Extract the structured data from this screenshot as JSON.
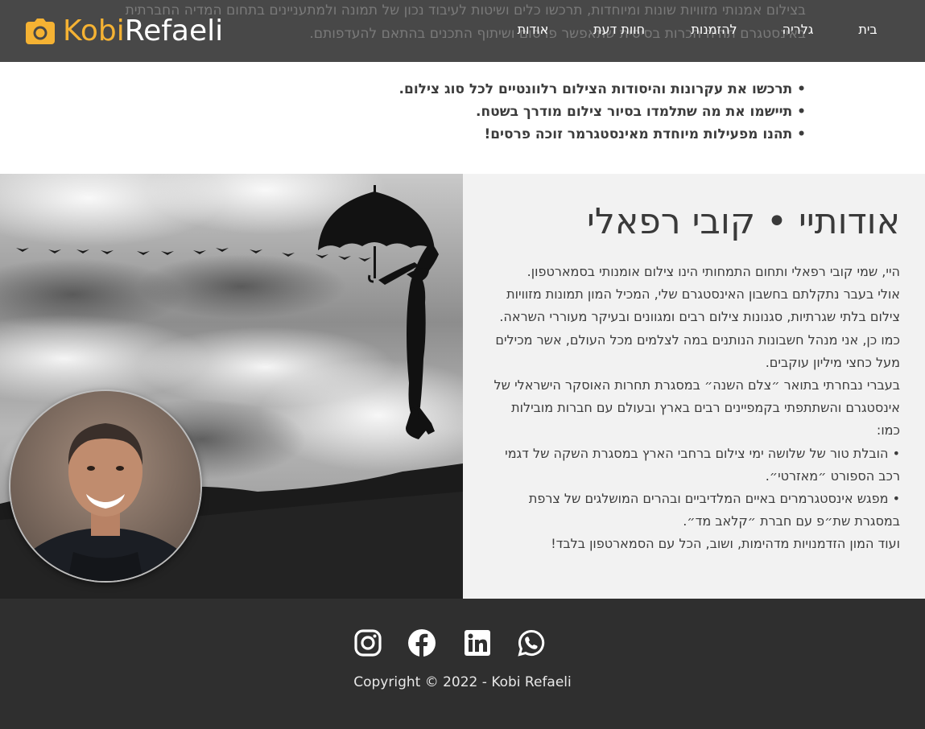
{
  "header": {
    "logo_part1": "Kobi",
    "logo_part2": "Refaeli",
    "nav": [
      {
        "label": "בית"
      },
      {
        "label": "גלריה"
      },
      {
        "label": "להזמנות"
      },
      {
        "label": "חוות דעת"
      },
      {
        "label": "אודות"
      }
    ],
    "behind_text_line1": "בצילום אמנותי מזוויות שונות ומיוחדות, תרכשו כלים ושיטות לעיבוד נכון של תמונה ולמתעניינים בתחום המדיה החברתית",
    "behind_text_line2": "באינסטגרם תהיה הכרות בסיסית שתאפשר פרסום ושיתוף התכנים בהתאם להעדפותם."
  },
  "bullets": [
    "• תרכשו את עקרונות והיסודות הצילום רלוונטיים לכל סוג צילום.",
    "• תיישמו את מה שתלמדו בסיור צילום מודרך בשטח.",
    "• תהנו מפעילות מיוחדת מאינסטגרמר זוכה פרסים!"
  ],
  "about": {
    "title": "אודותיי • קובי רפאלי",
    "paragraphs": [
      "היי, שמי קובי רפאלי ותחום התמחותי הינו צילום אומנותי בסמארטפון.",
      "אולי בעבר נתקלתם בחשבון האינסטגרם שלי, המכיל המון תמונות מזוויות צילום בלתי שגרתיות, סגנונות צילום רבים ומגוונים ובעיקר מעוררי השראה.",
      "כמו כן, אני מנהל חשבונות הנותנים במה לצלמים מכל העולם, אשר מכילים מעל כחצי מיליון עוקבים.",
      "בעברי נבחרתי בתואר ״צלם השנה״ במסגרת תחרות האוסקר הישראלי של אינסטגרם והשתתפתי בקמפיינים רבים בארץ ובעולם עם חברות מובילות כמו:",
      "• הובלת טור של שלושה ימי צילום ברחבי הארץ במסגרת השקה של דגמי רכב הספורט ״מאזרטי״.",
      "• מפגש אינסטגרמרים באיים המלדיביים ובהרים המושלגים של צרפת במסגרת שת״פ עם חברת ״קלאב מד״.",
      "ועוד המון הזדמנויות מדהימות, ושוב, הכל עם הסמארטפון בלבד!"
    ]
  },
  "footer": {
    "social_icons": [
      "instagram-icon",
      "facebook-icon",
      "linkedin-icon",
      "whatsapp-icon"
    ],
    "copyright": "Copyright © 2022 - Kobi Refaeli"
  },
  "colors": {
    "brand_orange": "#f5b233",
    "header_bg": "#484848",
    "footer_bg": "#2f2f2f",
    "about_bg": "#f2f2f2"
  }
}
